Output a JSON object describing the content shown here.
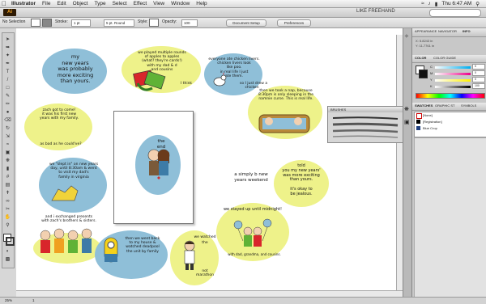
{
  "menubar": {
    "app": "Illustrator",
    "items": [
      "File",
      "Edit",
      "Object",
      "Type",
      "Select",
      "Effect",
      "View",
      "Window",
      "Help"
    ],
    "clock": "Thu 6:47 AM"
  },
  "appbar": {
    "app_badge": "Ai",
    "workspace": "LIKE FREEHAND"
  },
  "controlbar": {
    "selection": "No Selection",
    "stroke_label": "Stroke:",
    "stroke_value": "1 pt",
    "brush_value": "5 pt. Round",
    "style_label": "Style:",
    "opacity_label": "Opacity:",
    "opacity_value": "100",
    "doc_setup": "Document Setup",
    "preferences": "Preferences"
  },
  "bubbles": {
    "b1": "my\nnew years\nwas probably\nmore exciting\nthan yours.",
    "b2": "we played multiple rounds\nof apples to apples\n(what? they're cards!)\nwith my dad & d\nand cousins",
    "b2b": "I think",
    "b3": "everyone ate chicken livers.\nchicken livers look\nlike poo.\nin real life I just\nate them.",
    "b3b": "so I just drew a\nchicken",
    "b4": "then we took a nap, because\n8:30pm is only sleeping in the\nnamnie curse. This is real life.",
    "b5": "zach got to come!\nit was his first new\nyears with my family.",
    "b5b": "as bad as he could've?",
    "b6": "we \"slept in\" on new years\nday, until 8:30am & went\nto visit my dad's\nfamily in virginia",
    "b7": "and i exchanged presents\nwith zach's brothers & sisters.",
    "b8": "then we went back\nto my house &\nwatched deadpool\nthe unit by family",
    "b9": "we watched the",
    "b9b": "not\nmarathon",
    "b10": "we stayed up until midnight!",
    "b10b": "with dad, grandma, and cousins.",
    "b11": "told\nyou my new years'\nwas more exciting\nthan yours.",
    "b11b": "it's okay to\nbe jealous.",
    "center": "a simply b new years weekend",
    "artboard_text": "the end"
  },
  "panels": {
    "appearance_tabs": [
      "APPEARANCE",
      "NAVIGATOR",
      "INFO"
    ],
    "info_x": "X: 5.8243 in",
    "info_y": "Y: 11.7761 in",
    "color_tabs": [
      "COLOR",
      "COLOR GUIDE"
    ],
    "color_labels": [
      "C",
      "M",
      "Y",
      "K"
    ],
    "color_values": [
      "0",
      "0",
      "0",
      "100"
    ],
    "brushes_title": "BRUSHES",
    "swatch_tabs": [
      "SWATCHES",
      "GRAPHIC ST",
      "SYMBOLS"
    ],
    "swatch_items": [
      "[None]",
      "[Registration]",
      "Blue Crop"
    ]
  },
  "status": {
    "zoom": "25%",
    "page": "1"
  },
  "colors": {
    "accent": "#f7a623",
    "bubble_blue": "#8fbfd8",
    "bubble_yellow": "#eef28a"
  }
}
